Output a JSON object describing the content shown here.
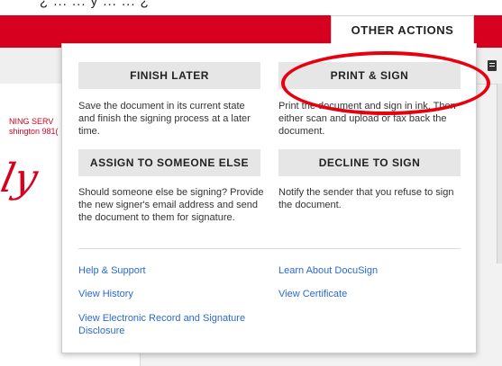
{
  "top_strip": {
    "text": "¿ ... ... y ... ... ¿"
  },
  "header": {
    "other_actions_label": "OTHER ACTIONS"
  },
  "document": {
    "line1": "NING SERV",
    "line2": "shington 981(",
    "signature": "ly"
  },
  "actions": {
    "finish_later": {
      "label": "FINISH LATER",
      "description": "Save the document in its current state and finish the signing process at a later time."
    },
    "print_sign": {
      "label": "PRINT & SIGN",
      "description": "Print the document and sign in ink. Then either scan and upload or fax back the document."
    },
    "assign": {
      "label": "ASSIGN TO SOMEONE ELSE",
      "description": "Should someone else be signing? Provide the new signer's email address and send the document to them for signature."
    },
    "decline": {
      "label": "DECLINE TO SIGN",
      "description": "Notify the sender that you refuse to sign the document."
    }
  },
  "links": {
    "help": "Help & Support",
    "learn": "Learn About DocuSign",
    "history": "View History",
    "certificate": "View Certificate",
    "electronic_record": "View Electronic Record and Signature Disclosure"
  },
  "colors": {
    "brand_red": "#d7001f",
    "link_blue": "#2b6ad1",
    "annotation_red": "#e8000f"
  }
}
